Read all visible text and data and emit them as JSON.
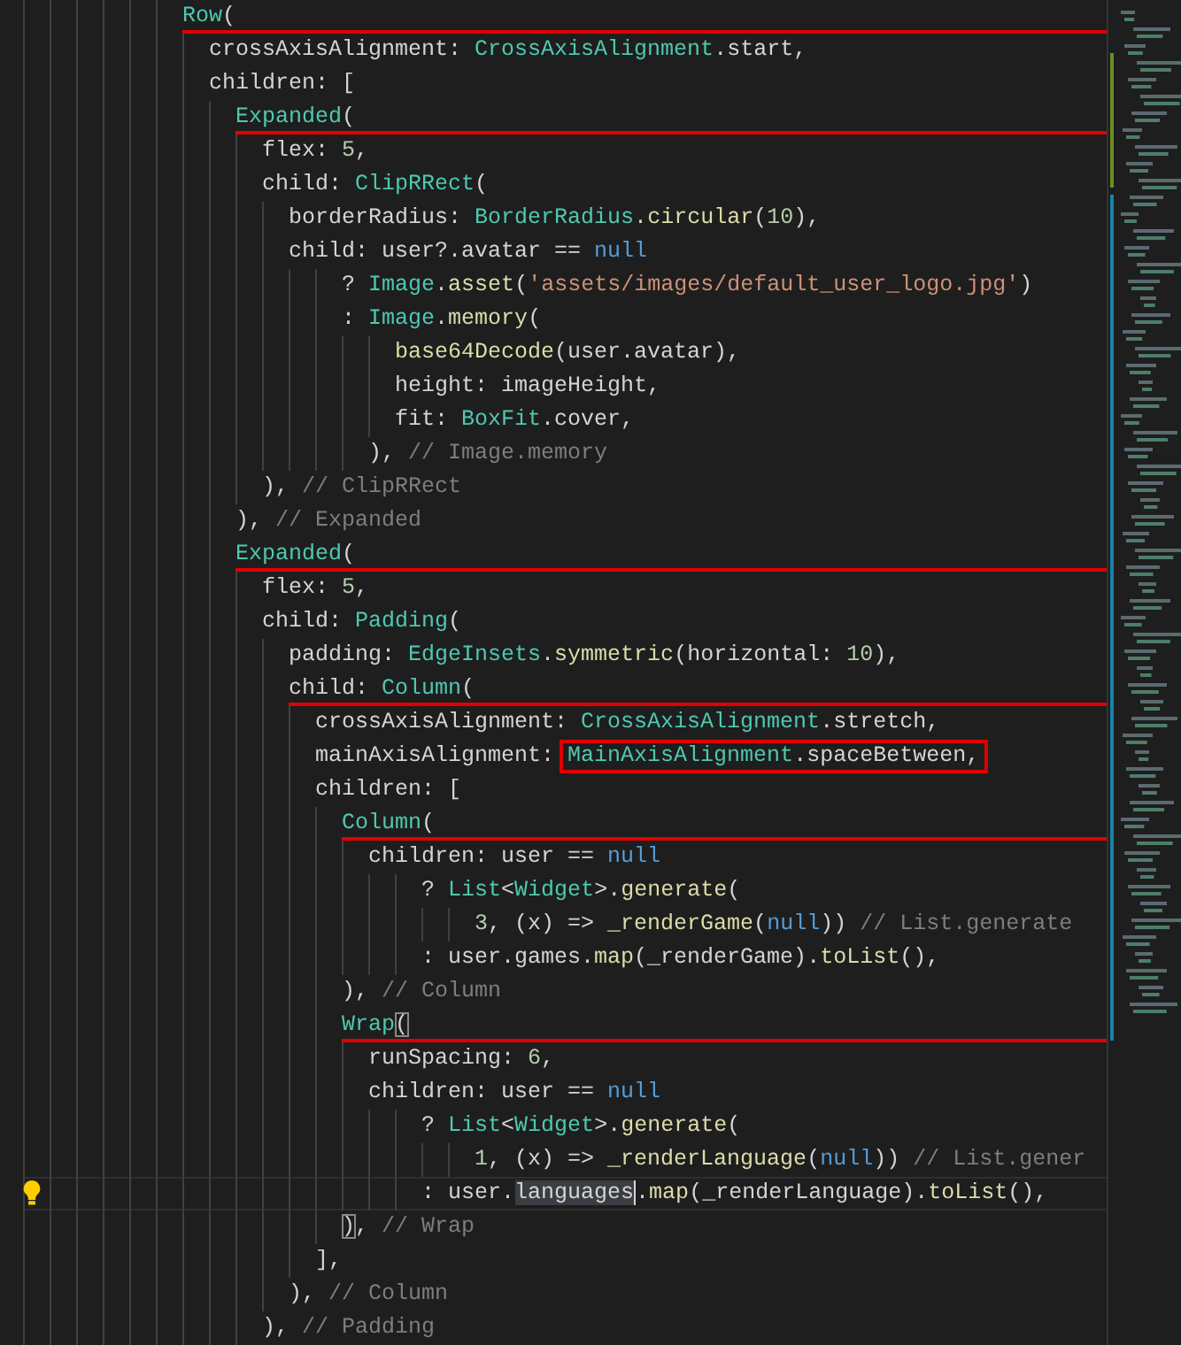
{
  "editor": {
    "lines": [
      {
        "underlined": true,
        "current": false,
        "tokens": [
          {
            "kind": "type",
            "text": "            Row"
          },
          {
            "kind": "plain",
            "text": "("
          }
        ]
      },
      {
        "underlined": false,
        "current": false,
        "tokens": [
          {
            "kind": "plain",
            "text": "              crossAxisAlignment: "
          },
          {
            "kind": "type",
            "text": "CrossAxisAlignment"
          },
          {
            "kind": "plain",
            "text": ".start,"
          }
        ]
      },
      {
        "underlined": false,
        "current": false,
        "tokens": [
          {
            "kind": "plain",
            "text": "              children: ["
          }
        ]
      },
      {
        "underlined": true,
        "current": false,
        "tokens": [
          {
            "kind": "type",
            "text": "                Expanded"
          },
          {
            "kind": "plain",
            "text": "("
          }
        ]
      },
      {
        "underlined": false,
        "current": false,
        "tokens": [
          {
            "kind": "plain",
            "text": "                  flex: "
          },
          {
            "kind": "number",
            "text": "5"
          },
          {
            "kind": "plain",
            "text": ","
          }
        ]
      },
      {
        "underlined": false,
        "current": false,
        "tokens": [
          {
            "kind": "plain",
            "text": "                  child: "
          },
          {
            "kind": "type",
            "text": "ClipRRect"
          },
          {
            "kind": "plain",
            "text": "("
          }
        ]
      },
      {
        "underlined": false,
        "current": false,
        "tokens": [
          {
            "kind": "plain",
            "text": "                    borderRadius: "
          },
          {
            "kind": "type",
            "text": "BorderRadius"
          },
          {
            "kind": "plain",
            "text": "."
          },
          {
            "kind": "method",
            "text": "circular"
          },
          {
            "kind": "plain",
            "text": "("
          },
          {
            "kind": "number",
            "text": "10"
          },
          {
            "kind": "plain",
            "text": "),"
          }
        ]
      },
      {
        "underlined": false,
        "current": false,
        "tokens": [
          {
            "kind": "plain",
            "text": "                    child: user?.avatar == "
          },
          {
            "kind": "keyword",
            "text": "null"
          }
        ]
      },
      {
        "underlined": false,
        "current": false,
        "tokens": [
          {
            "kind": "plain",
            "text": "                        ? "
          },
          {
            "kind": "type",
            "text": "Image"
          },
          {
            "kind": "plain",
            "text": "."
          },
          {
            "kind": "method",
            "text": "asset"
          },
          {
            "kind": "plain",
            "text": "("
          },
          {
            "kind": "string",
            "text": "'assets/images/default_user_logo.jpg'"
          },
          {
            "kind": "plain",
            "text": ")"
          }
        ]
      },
      {
        "underlined": false,
        "current": false,
        "tokens": [
          {
            "kind": "plain",
            "text": "                        : "
          },
          {
            "kind": "type",
            "text": "Image"
          },
          {
            "kind": "plain",
            "text": "."
          },
          {
            "kind": "method",
            "text": "memory"
          },
          {
            "kind": "plain",
            "text": "("
          }
        ]
      },
      {
        "underlined": false,
        "current": false,
        "tokens": [
          {
            "kind": "method",
            "text": "                            base64Decode"
          },
          {
            "kind": "plain",
            "text": "(user.avatar),"
          }
        ]
      },
      {
        "underlined": false,
        "current": false,
        "tokens": [
          {
            "kind": "plain",
            "text": "                            height: imageHeight,"
          }
        ]
      },
      {
        "underlined": false,
        "current": false,
        "tokens": [
          {
            "kind": "plain",
            "text": "                            fit: "
          },
          {
            "kind": "type",
            "text": "BoxFit"
          },
          {
            "kind": "plain",
            "text": ".cover,"
          }
        ]
      },
      {
        "underlined": false,
        "current": false,
        "tokens": [
          {
            "kind": "plain",
            "text": "                          ), "
          },
          {
            "kind": "comment",
            "text": "// Image.memory"
          }
        ]
      },
      {
        "underlined": false,
        "current": false,
        "tokens": [
          {
            "kind": "plain",
            "text": "                  ), "
          },
          {
            "kind": "comment",
            "text": "// ClipRRect"
          }
        ]
      },
      {
        "underlined": false,
        "current": false,
        "tokens": [
          {
            "kind": "plain",
            "text": "                ), "
          },
          {
            "kind": "comment",
            "text": "// Expanded"
          }
        ]
      },
      {
        "underlined": true,
        "current": false,
        "tokens": [
          {
            "kind": "type",
            "text": "                Expanded"
          },
          {
            "kind": "plain",
            "text": "("
          }
        ]
      },
      {
        "underlined": false,
        "current": false,
        "tokens": [
          {
            "kind": "plain",
            "text": "                  flex: "
          },
          {
            "kind": "number",
            "text": "5"
          },
          {
            "kind": "plain",
            "text": ","
          }
        ]
      },
      {
        "underlined": false,
        "current": false,
        "tokens": [
          {
            "kind": "plain",
            "text": "                  child: "
          },
          {
            "kind": "type",
            "text": "Padding"
          },
          {
            "kind": "plain",
            "text": "("
          }
        ]
      },
      {
        "underlined": false,
        "current": false,
        "tokens": [
          {
            "kind": "plain",
            "text": "                    padding: "
          },
          {
            "kind": "type",
            "text": "EdgeInsets"
          },
          {
            "kind": "plain",
            "text": "."
          },
          {
            "kind": "method",
            "text": "symmetric"
          },
          {
            "kind": "plain",
            "text": "(horizontal: "
          },
          {
            "kind": "number",
            "text": "10"
          },
          {
            "kind": "plain",
            "text": "),"
          }
        ]
      },
      {
        "underlined": true,
        "current": false,
        "tokens": [
          {
            "kind": "plain",
            "text": "                    child: "
          },
          {
            "kind": "type",
            "text": "Column"
          },
          {
            "kind": "plain",
            "text": "("
          }
        ]
      },
      {
        "underlined": false,
        "current": false,
        "tokens": [
          {
            "kind": "plain",
            "text": "                      crossAxisAlignment: "
          },
          {
            "kind": "type",
            "text": "CrossAxisAlignment"
          },
          {
            "kind": "plain",
            "text": ".stretch,"
          }
        ]
      },
      {
        "underlined": false,
        "current": false,
        "tokens": [
          {
            "kind": "plain",
            "text": "                      mainAxisAlignment: "
          },
          {
            "kind": "annotation_box",
            "tokens": [
              {
                "kind": "type",
                "text": "MainAxisAlignment"
              },
              {
                "kind": "plain",
                "text": ".spaceBetween,"
              }
            ]
          }
        ]
      },
      {
        "underlined": false,
        "current": false,
        "tokens": [
          {
            "kind": "plain",
            "text": "                      children: ["
          }
        ]
      },
      {
        "underlined": true,
        "current": false,
        "tokens": [
          {
            "kind": "type",
            "text": "                        Column"
          },
          {
            "kind": "plain",
            "text": "("
          }
        ]
      },
      {
        "underlined": false,
        "current": false,
        "tokens": [
          {
            "kind": "plain",
            "text": "                          children: user == "
          },
          {
            "kind": "keyword",
            "text": "null"
          }
        ]
      },
      {
        "underlined": false,
        "current": false,
        "tokens": [
          {
            "kind": "plain",
            "text": "                              ? "
          },
          {
            "kind": "type",
            "text": "List"
          },
          {
            "kind": "plain",
            "text": "<"
          },
          {
            "kind": "type",
            "text": "Widget"
          },
          {
            "kind": "plain",
            "text": ">."
          },
          {
            "kind": "method",
            "text": "generate"
          },
          {
            "kind": "plain",
            "text": "("
          }
        ]
      },
      {
        "underlined": false,
        "current": false,
        "tokens": [
          {
            "kind": "number",
            "text": "                                  3"
          },
          {
            "kind": "plain",
            "text": ", (x) => "
          },
          {
            "kind": "method",
            "text": "_renderGame"
          },
          {
            "kind": "plain",
            "text": "("
          },
          {
            "kind": "keyword",
            "text": "null"
          },
          {
            "kind": "plain",
            "text": ")) "
          },
          {
            "kind": "comment",
            "text": "// List.generate"
          }
        ]
      },
      {
        "underlined": false,
        "current": false,
        "tokens": [
          {
            "kind": "plain",
            "text": "                              : user.games."
          },
          {
            "kind": "method",
            "text": "map"
          },
          {
            "kind": "plain",
            "text": "(_renderGame)."
          },
          {
            "kind": "method",
            "text": "toList"
          },
          {
            "kind": "plain",
            "text": "(),"
          }
        ]
      },
      {
        "underlined": false,
        "current": false,
        "tokens": [
          {
            "kind": "plain",
            "text": "                        ), "
          },
          {
            "kind": "comment",
            "text": "// Column"
          }
        ]
      },
      {
        "underlined": true,
        "current": false,
        "tokens": [
          {
            "kind": "type",
            "text": "                        Wrap"
          },
          {
            "kind": "bracket_match",
            "text": "("
          }
        ]
      },
      {
        "underlined": false,
        "current": false,
        "tokens": [
          {
            "kind": "plain",
            "text": "                          runSpacing: "
          },
          {
            "kind": "number",
            "text": "6"
          },
          {
            "kind": "plain",
            "text": ","
          }
        ]
      },
      {
        "underlined": false,
        "current": false,
        "tokens": [
          {
            "kind": "plain",
            "text": "                          children: user == "
          },
          {
            "kind": "keyword",
            "text": "null"
          }
        ]
      },
      {
        "underlined": false,
        "current": false,
        "tokens": [
          {
            "kind": "plain",
            "text": "                              ? "
          },
          {
            "kind": "type",
            "text": "List"
          },
          {
            "kind": "plain",
            "text": "<"
          },
          {
            "kind": "type",
            "text": "Widget"
          },
          {
            "kind": "plain",
            "text": ">."
          },
          {
            "kind": "method",
            "text": "generate"
          },
          {
            "kind": "plain",
            "text": "("
          }
        ]
      },
      {
        "underlined": false,
        "current": false,
        "tokens": [
          {
            "kind": "number",
            "text": "                                  1"
          },
          {
            "kind": "plain",
            "text": ", (x) => "
          },
          {
            "kind": "method",
            "text": "_renderLanguage"
          },
          {
            "kind": "plain",
            "text": "("
          },
          {
            "kind": "keyword",
            "text": "null"
          },
          {
            "kind": "plain",
            "text": ")) "
          },
          {
            "kind": "comment",
            "text": "// List.gener"
          }
        ]
      },
      {
        "underlined": false,
        "current": true,
        "tokens": [
          {
            "kind": "plain",
            "text": "                              : user."
          },
          {
            "kind": "word_highlight",
            "text": "languages"
          },
          {
            "kind": "plain",
            "text": "."
          },
          {
            "kind": "method",
            "text": "map"
          },
          {
            "kind": "plain",
            "text": "(_renderLanguage)."
          },
          {
            "kind": "method",
            "text": "toList"
          },
          {
            "kind": "plain",
            "text": "(),"
          }
        ]
      },
      {
        "underlined": false,
        "current": false,
        "tokens": [
          {
            "kind": "bracket_match",
            "text": "                        )"
          },
          {
            "kind": "plain",
            "text": ", "
          },
          {
            "kind": "comment",
            "text": "// Wrap"
          }
        ]
      },
      {
        "underlined": false,
        "current": false,
        "tokens": [
          {
            "kind": "plain",
            "text": "                      ],"
          }
        ]
      },
      {
        "underlined": false,
        "current": false,
        "tokens": [
          {
            "kind": "plain",
            "text": "                    ), "
          },
          {
            "kind": "comment",
            "text": "// Column"
          }
        ]
      },
      {
        "underlined": false,
        "current": false,
        "tokens": [
          {
            "kind": "plain",
            "text": "                  ), "
          },
          {
            "kind": "comment",
            "text": "// Padding"
          }
        ]
      }
    ]
  }
}
